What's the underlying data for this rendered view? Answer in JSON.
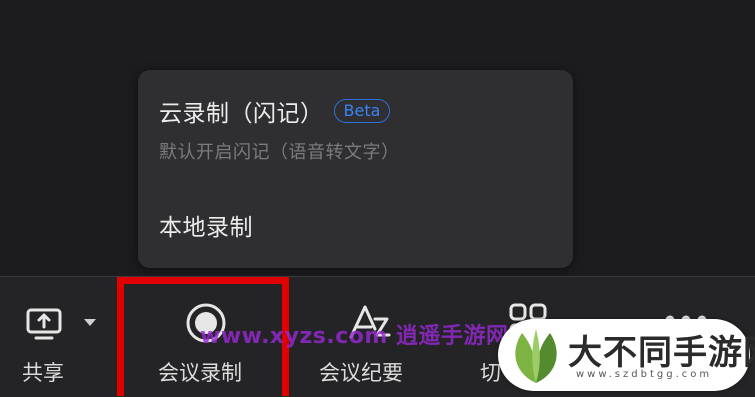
{
  "popup": {
    "cloud_title": "云录制（闪记）",
    "beta_badge": "Beta",
    "cloud_subtitle": "默认开启闪记（语音转文字）",
    "local_label": "本地录制"
  },
  "toolbar": {
    "share_label": "共享",
    "record_label": "会议录制",
    "summary_label": "会议纪要",
    "switch_label": "切",
    "icons": {
      "share": "screen-share-icon",
      "record": "record-icon",
      "summary": "ai-summary-icon",
      "switch": "grid-icon",
      "more": "more-icon"
    }
  },
  "watermark": {
    "url": "www.xyzs.com 逍遥手游网",
    "badge_title": "大不同手游网",
    "badge_sub": "www.szdbtgg.com"
  },
  "colors": {
    "highlight": "#e00000",
    "beta": "#3b82f6",
    "background": "#1c1c1e",
    "popup": "#2f2f31"
  }
}
